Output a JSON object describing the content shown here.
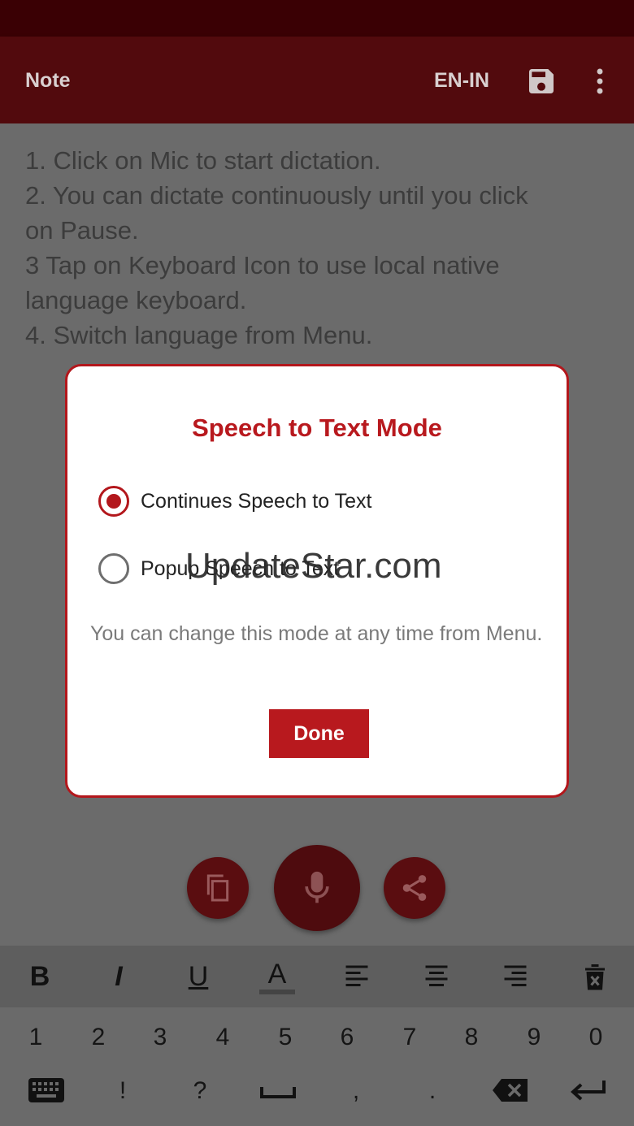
{
  "app_bar": {
    "title": "Note",
    "language": "EN-IN",
    "save_icon": "save-icon",
    "menu_icon": "more-vert-icon"
  },
  "note": {
    "lines": [
      "1. Click on Mic to start dictation.",
      "2. You can dictate continuously until you click",
      "on Pause.",
      "3 Tap on Keyboard Icon to use local native",
      "language keyboard.",
      "4. Switch language from Menu."
    ]
  },
  "dialog": {
    "title": "Speech to Text Mode",
    "options": [
      {
        "label": "Continues Speech to Text",
        "selected": true
      },
      {
        "label": "Popup Speech to Text",
        "selected": false
      }
    ],
    "hint": "You can change this mode at any time from Menu.",
    "done_label": "Done"
  },
  "watermark": "UpdateStar.com",
  "actions": {
    "copy_icon": "copy-icon",
    "mic_icon": "mic-icon",
    "share_icon": "share-icon"
  },
  "format_bar": {
    "bold": "B",
    "italic": "I",
    "underline": "U",
    "text_color": "A"
  },
  "keyboard": {
    "numbers": [
      "1",
      "2",
      "3",
      "4",
      "5",
      "6",
      "7",
      "8",
      "9",
      "0"
    ],
    "symbols": [
      "!",
      "?",
      ",",
      "."
    ]
  },
  "colors": {
    "accent": "#b8191e",
    "app_bar": "#520a0d",
    "status_bar": "#3a0004"
  }
}
